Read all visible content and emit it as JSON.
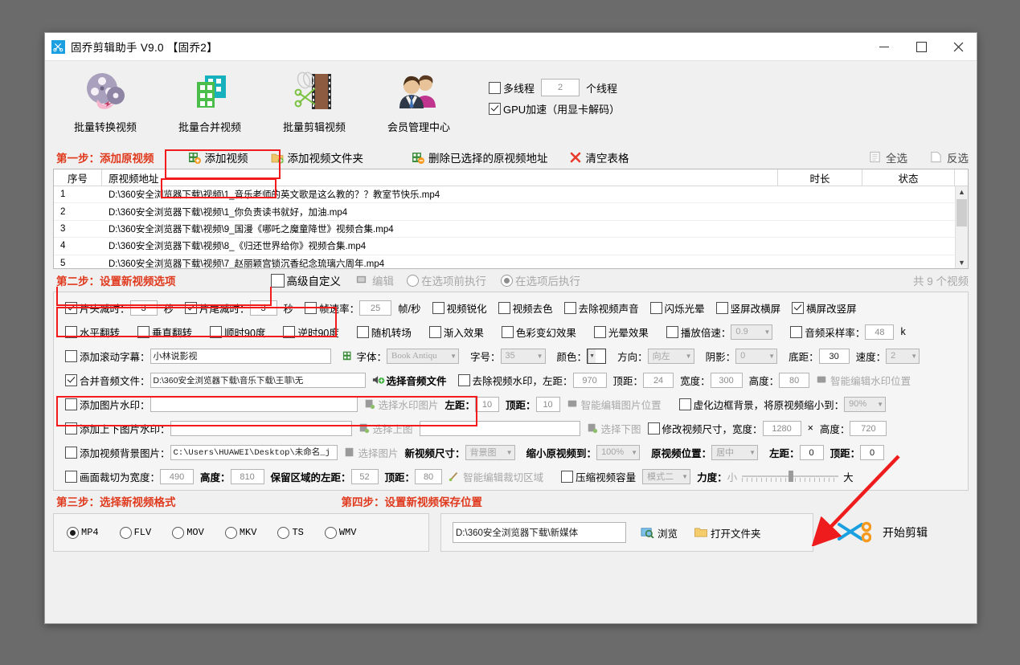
{
  "window": {
    "title": "固乔剪辑助手 V9.0  【固乔2】",
    "app_icon": "scissors-icon",
    "minimize": "—",
    "maximize": "□",
    "close": "✕"
  },
  "toolbar": {
    "items": [
      {
        "label": "批量转换视频",
        "icon": "film-reel-icon"
      },
      {
        "label": "批量合并视频",
        "icon": "merge-blocks-icon"
      },
      {
        "label": "批量剪辑视频",
        "icon": "film-scissors-icon"
      },
      {
        "label": "会员管理中心",
        "icon": "members-icon"
      }
    ],
    "multithread_label": "多线程",
    "multithread_checked": false,
    "thread_count": "2",
    "thread_unit": "个线程",
    "gpu_label": "GPU加速（用显卡解码）",
    "gpu_checked": true
  },
  "step1": {
    "label": "第一步：添加原视频",
    "add_video": "添加视频",
    "add_folder": "添加视频文件夹",
    "delete_selected": "删除已选择的原视频地址",
    "clear_table": "清空表格",
    "select_all": "全选",
    "invert_select": "反选"
  },
  "table": {
    "headers": [
      "序号",
      "原视频地址",
      "时长",
      "状态"
    ],
    "rows": [
      {
        "no": "1",
        "path": "D:\\360安全浏览器下载\\视频\\1_音乐老师的英文歌是这么教的？？教室节快乐.mp4",
        "duration": "",
        "status": ""
      },
      {
        "no": "2",
        "path": "D:\\360安全浏览器下载\\视频\\1_你负责读书就好，加油.mp4",
        "duration": "",
        "status": ""
      },
      {
        "no": "3",
        "path": "D:\\360安全浏览器下载\\视频\\9_国漫《哪吒之魔童降世》视频合集.mp4",
        "duration": "",
        "status": ""
      },
      {
        "no": "4",
        "path": "D:\\360安全浏览器下载\\视频\\8_《归还世界给你》视频合集.mp4",
        "duration": "",
        "status": ""
      },
      {
        "no": "5",
        "path": "D:\\360安全浏览器下载\\视频\\7_赵丽颖宫锁沉香纪念琉璃六周年.mp4",
        "duration": "",
        "status": ""
      }
    ]
  },
  "step2": {
    "label": "第二步：设置新视频选项",
    "advanced_label": "高级自定义",
    "advanced_checked": false,
    "edit_label": "编辑",
    "exec_before": "在选项前执行",
    "exec_after": "在选项后执行",
    "exec_selected": "after",
    "total_text": "共 9 个视频",
    "row1": {
      "head_trim_label": "片头减时：",
      "head_trim_checked": true,
      "head_trim_value": "3",
      "head_trim_unit": "秒",
      "tail_trim_label": "片尾减时：",
      "tail_trim_checked": true,
      "tail_trim_value": "3",
      "tail_trim_unit": "秒",
      "fps_label": "帧速率：",
      "fps_checked": false,
      "fps_value": "25",
      "fps_unit": "帧/秒",
      "sharpen": "视频锐化",
      "sharpen_checked": false,
      "decolor": "视频去色",
      "decolor_checked": false,
      "mute": "去除视频声音",
      "mute_checked": false,
      "flicker": "闪烁光晕",
      "flicker_checked": false,
      "v2h": "竖屏改横屏",
      "v2h_checked": false,
      "h2v": "横屏改竖屏",
      "h2v_checked": true
    },
    "row2": {
      "hflip": "水平翻转",
      "vflip": "垂直翻转",
      "rot_cw": "顺时90度",
      "rot_ccw": "逆时90度",
      "random_transition": "随机转场",
      "fade_in": "渐入效果",
      "color_shift": "色彩变幻效果",
      "halo": "光晕效果",
      "speed_label": "播放倍速：",
      "speed_value": "0.9",
      "samplerate_label": "音频采样率：",
      "samplerate_value": "48",
      "samplerate_unit": "k"
    },
    "row3": {
      "scroll_sub_label": "添加滚动字幕：",
      "scroll_sub_checked": false,
      "scroll_sub_value": "小林说影视",
      "font_label": "字体：",
      "font_value": "Book Antiqu",
      "size_label": "字号：",
      "size_value": "35",
      "color_label": "颜色：",
      "direction_label": "方向：",
      "direction_value": "向左",
      "shadow_label": "阴影：",
      "shadow_value": "0",
      "bottom_label": "底距：",
      "bottom_value": "30",
      "speed_label": "速度：",
      "speed_value": "2"
    },
    "row4": {
      "merge_audio_label": "合并音频文件：",
      "merge_audio_checked": true,
      "audio_path": "D:\\360安全浏览器下载\\音乐下载\\王菲\\无",
      "choose_audio_btn": "选择音频文件",
      "remove_wm_label": "去除视频水印，左距：",
      "remove_wm_checked": false,
      "wm_left": "970",
      "wm_top_label": "顶距：",
      "wm_top": "24",
      "wm_w_label": "宽度：",
      "wm_w": "300",
      "wm_h_label": "高度：",
      "wm_h": "80",
      "smart_wm_btn": "智能编辑水印位置"
    },
    "row5": {
      "img_wm_label": "添加图片水印：",
      "img_wm_checked": false,
      "img_wm_value": "",
      "choose_wm_img": "选择水印图片",
      "left_label": "左距：",
      "left_value": "10",
      "top_label": "顶距：",
      "top_value": "10",
      "smart_img_btn": "智能编辑图片位置",
      "blur_bg_label": "虚化边框背景，将原视频缩小到：",
      "blur_bg_checked": false,
      "blur_bg_value": "90%"
    },
    "row6": {
      "tb_img_wm_label": "添加上下图片水印：",
      "tb_img_wm_checked": false,
      "top_img_value": "",
      "choose_top_img": "选择上图",
      "bottom_img_value": "",
      "choose_bottom_img": "选择下图",
      "resize_label": "修改视频尺寸，宽度：",
      "resize_checked": false,
      "resize_w": "1280",
      "x_label": "×",
      "resize_h_label": "高度：",
      "resize_h": "720"
    },
    "row7": {
      "bg_img_label": "添加视频背景图片：",
      "bg_img_checked": false,
      "bg_img_path": "C:\\Users\\HUAWEI\\Desktop\\未命名_j",
      "choose_img": "选择图片",
      "new_size_label": "新视频尺寸：",
      "new_size_value": "背景图",
      "shrink_label": "缩小原视频到：",
      "shrink_value": "100%",
      "pos_label": "原视频位置：",
      "pos_value": "居中",
      "left_label": "左距：",
      "left_value": "0",
      "top_label": "顶距：",
      "top_value": "0"
    },
    "row8": {
      "crop_label": "画面裁切为宽度：",
      "crop_checked": false,
      "crop_w": "490",
      "crop_h_label": "高度：",
      "crop_h": "810",
      "keep_left_label": "保留区域的左距：",
      "keep_left": "52",
      "keep_top_label": "顶距：",
      "keep_top": "80",
      "smart_crop_btn": "智能编辑裁切区域",
      "compress_label": "压缩视频容量",
      "compress_checked": false,
      "mode_value": "模式二",
      "strength_label": "力度：",
      "strength_min": "小",
      "strength_max": "大"
    }
  },
  "step3": {
    "label": "第三步：选择新视频格式",
    "formats": [
      "MP4",
      "FLV",
      "MOV",
      "MKV",
      "TS",
      "WMV"
    ],
    "selected": "MP4"
  },
  "step4": {
    "label": "第四步：设置新视频保存位置",
    "save_path": "D:\\360安全浏览器下载\\新媒体",
    "browse": "浏览",
    "open_folder": "打开文件夹",
    "start": "开始剪辑"
  },
  "colors": {
    "accent_red": "#e03a1e",
    "highlight": "#f21b1b",
    "title_bg": "#ffffff",
    "panel_bg": "#f0f0f0"
  }
}
